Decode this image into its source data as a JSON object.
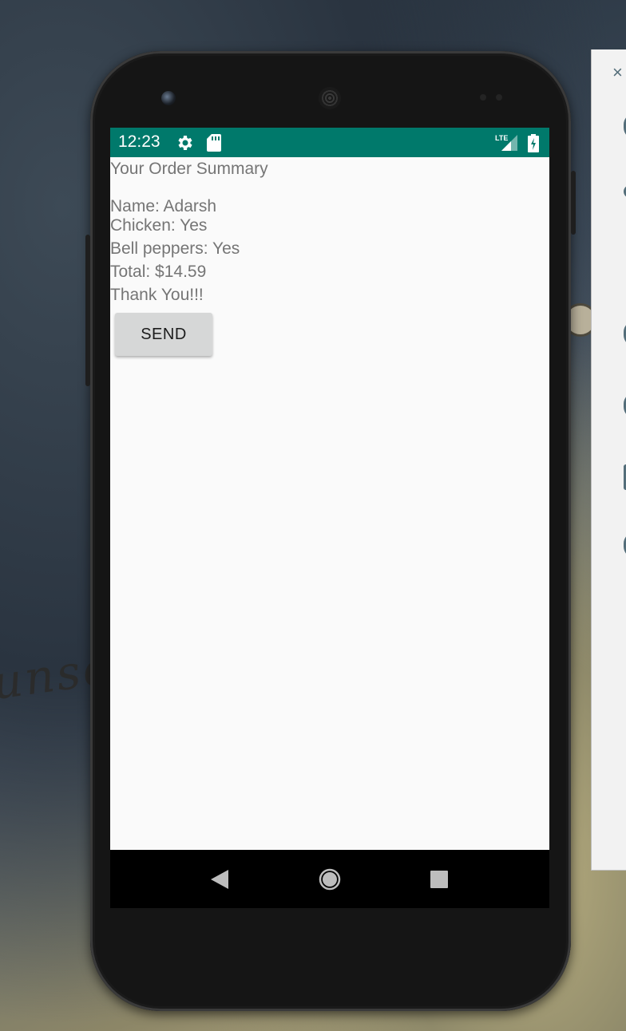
{
  "background": {
    "text": "unse"
  },
  "side_panel": {
    "close_glyph": "×"
  },
  "status_bar": {
    "time": "12:23",
    "network_label": "LTE",
    "color": "#00796b"
  },
  "summary": {
    "title": "Your Order Summary",
    "lines": [
      "Name: Adarsh",
      "Chicken: Yes",
      "Bell peppers: Yes",
      "Total: $14.59",
      "Thank You!!!"
    ]
  },
  "send_button": {
    "label": "SEND"
  },
  "nav_bar": {
    "icons": [
      "back-icon",
      "home-icon",
      "recents-icon"
    ]
  }
}
